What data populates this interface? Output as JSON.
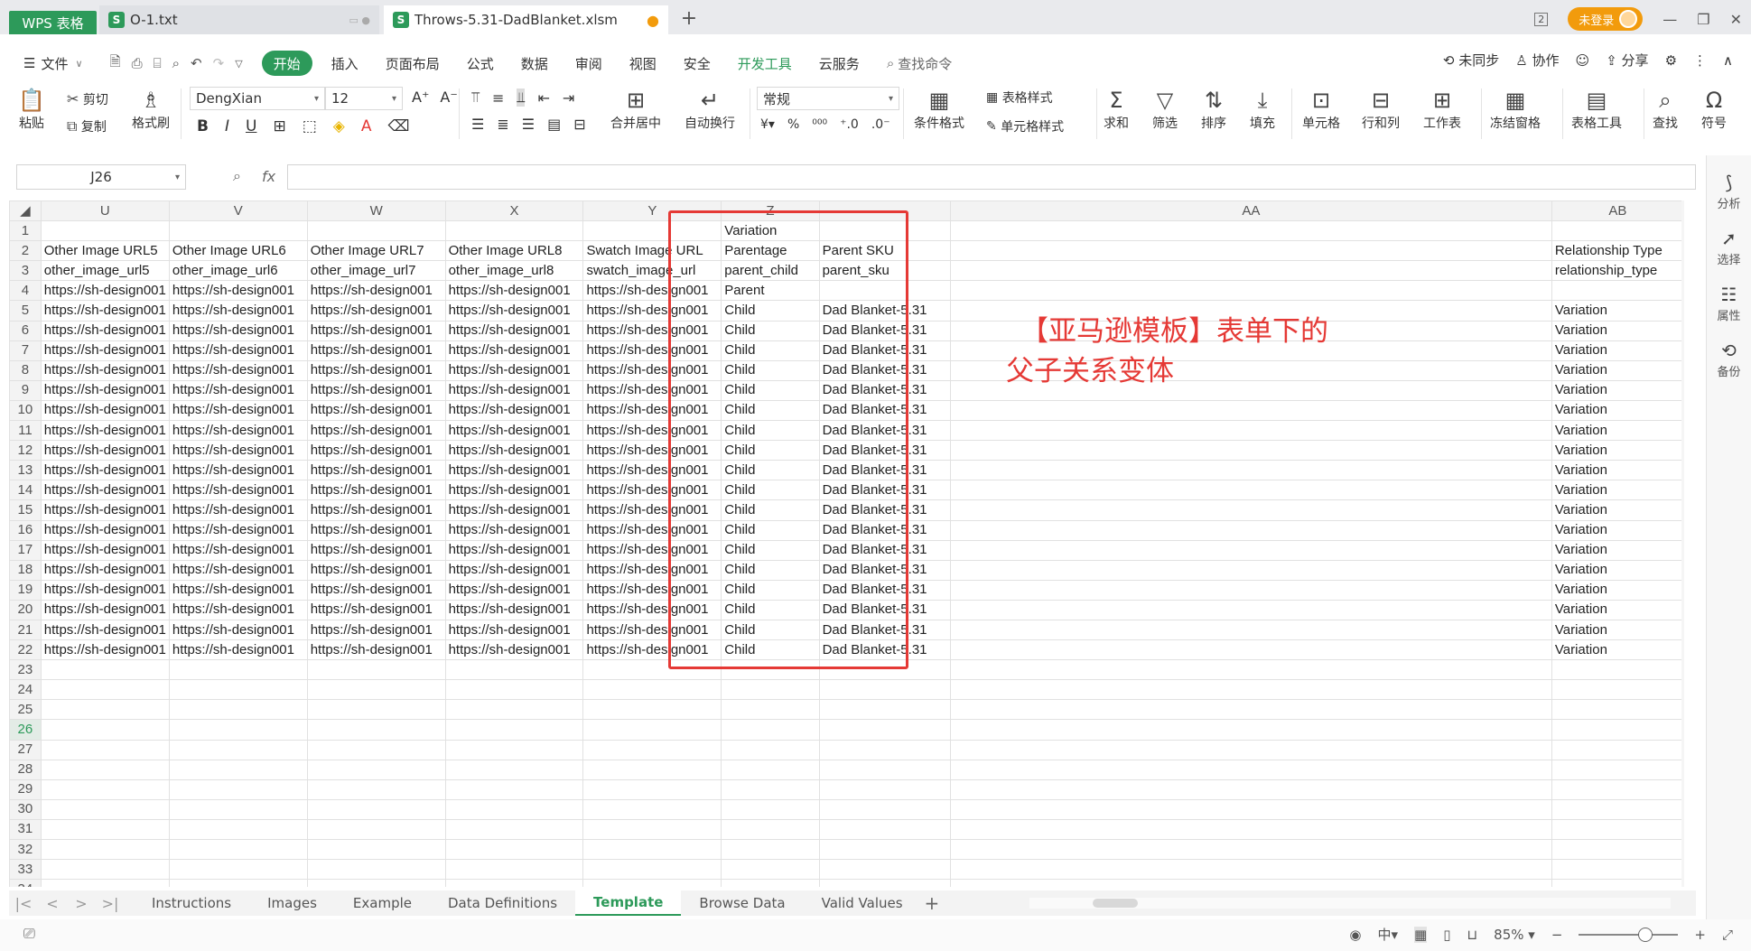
{
  "titlebar": {
    "tabs": [
      {
        "label": "WPS 表格"
      },
      {
        "label": "O-1.txt",
        "icon": "S"
      },
      {
        "label": "Throws-5.31-DadBlanket.xlsm",
        "icon": "S"
      }
    ],
    "new_tab": "+",
    "page_count": "2",
    "login": "未登录"
  },
  "menubar": {
    "file": "文件",
    "items": [
      "开始",
      "插入",
      "页面布局",
      "公式",
      "数据",
      "审阅",
      "视图",
      "安全",
      "开发工具",
      "云服务"
    ],
    "search": "查找命令",
    "right": [
      "未同步",
      "协作",
      "分享"
    ]
  },
  "toolbar": {
    "paste": "粘贴",
    "cut": "剪切",
    "copy": "复制",
    "format_painter": "格式刷",
    "font_name": "DengXian",
    "font_size": "12",
    "number_format": "常规",
    "merge": "合并居中",
    "wrap": "自动换行",
    "cond_format": "条件格式",
    "table_style": "表格样式",
    "cell_style": "单元格样式",
    "sum": "求和",
    "filter": "筛选",
    "sort": "排序",
    "fill": "填充",
    "cell": "单元格",
    "rowcol": "行和列",
    "sheet": "工作表",
    "freeze": "冻结窗格",
    "table_tools": "表格工具",
    "find": "查找",
    "symbol": "符号"
  },
  "formula": {
    "cell_ref": "J26",
    "fx": "fx",
    "value": ""
  },
  "columns": [
    "U",
    "V",
    "W",
    "X",
    "Y",
    "Z",
    "",
    "AA",
    "AB"
  ],
  "rows": [
    {
      "n": "1",
      "cells": [
        "",
        "",
        "",
        "",
        "",
        "Variation",
        "",
        "",
        ""
      ]
    },
    {
      "n": "2",
      "cells": [
        "Other Image URL5",
        "Other Image URL6",
        "Other Image URL7",
        "Other Image URL8",
        "Swatch Image URL",
        "Parentage",
        "Parent SKU",
        "",
        "Relationship Type"
      ]
    },
    {
      "n": "3",
      "cells": [
        "other_image_url5",
        "other_image_url6",
        "other_image_url7",
        "other_image_url8",
        "swatch_image_url",
        "parent_child",
        "parent_sku",
        "",
        "relationship_type"
      ]
    },
    {
      "n": "4",
      "cells": [
        "https://sh-design001",
        "https://sh-design001",
        "https://sh-design001",
        "https://sh-design001",
        "https://sh-design001",
        "Parent",
        "",
        "",
        ""
      ]
    },
    {
      "n": "5",
      "cells": [
        "https://sh-design001",
        "https://sh-design001",
        "https://sh-design001",
        "https://sh-design001",
        "https://sh-design001",
        "Child",
        "Dad Blanket-5.31",
        "",
        "Variation"
      ]
    },
    {
      "n": "6",
      "cells": [
        "https://sh-design001",
        "https://sh-design001",
        "https://sh-design001",
        "https://sh-design001",
        "https://sh-design001",
        "Child",
        "Dad Blanket-5.31",
        "",
        "Variation"
      ]
    },
    {
      "n": "7",
      "cells": [
        "https://sh-design001",
        "https://sh-design001",
        "https://sh-design001",
        "https://sh-design001",
        "https://sh-design001",
        "Child",
        "Dad Blanket-5.31",
        "",
        "Variation"
      ]
    },
    {
      "n": "8",
      "cells": [
        "https://sh-design001",
        "https://sh-design001",
        "https://sh-design001",
        "https://sh-design001",
        "https://sh-design001",
        "Child",
        "Dad Blanket-5.31",
        "",
        "Variation"
      ]
    },
    {
      "n": "9",
      "cells": [
        "https://sh-design001",
        "https://sh-design001",
        "https://sh-design001",
        "https://sh-design001",
        "https://sh-design001",
        "Child",
        "Dad Blanket-5.31",
        "",
        "Variation"
      ]
    },
    {
      "n": "10",
      "cells": [
        "https://sh-design001",
        "https://sh-design001",
        "https://sh-design001",
        "https://sh-design001",
        "https://sh-design001",
        "Child",
        "Dad Blanket-5.31",
        "",
        "Variation"
      ]
    },
    {
      "n": "11",
      "cells": [
        "https://sh-design001",
        "https://sh-design001",
        "https://sh-design001",
        "https://sh-design001",
        "https://sh-design001",
        "Child",
        "Dad Blanket-5.31",
        "",
        "Variation"
      ]
    },
    {
      "n": "12",
      "cells": [
        "https://sh-design001",
        "https://sh-design001",
        "https://sh-design001",
        "https://sh-design001",
        "https://sh-design001",
        "Child",
        "Dad Blanket-5.31",
        "",
        "Variation"
      ]
    },
    {
      "n": "13",
      "cells": [
        "https://sh-design001",
        "https://sh-design001",
        "https://sh-design001",
        "https://sh-design001",
        "https://sh-design001",
        "Child",
        "Dad Blanket-5.31",
        "",
        "Variation"
      ]
    },
    {
      "n": "14",
      "cells": [
        "https://sh-design001",
        "https://sh-design001",
        "https://sh-design001",
        "https://sh-design001",
        "https://sh-design001",
        "Child",
        "Dad Blanket-5.31",
        "",
        "Variation"
      ]
    },
    {
      "n": "15",
      "cells": [
        "https://sh-design001",
        "https://sh-design001",
        "https://sh-design001",
        "https://sh-design001",
        "https://sh-design001",
        "Child",
        "Dad Blanket-5.31",
        "",
        "Variation"
      ]
    },
    {
      "n": "16",
      "cells": [
        "https://sh-design001",
        "https://sh-design001",
        "https://sh-design001",
        "https://sh-design001",
        "https://sh-design001",
        "Child",
        "Dad Blanket-5.31",
        "",
        "Variation"
      ]
    },
    {
      "n": "17",
      "cells": [
        "https://sh-design001",
        "https://sh-design001",
        "https://sh-design001",
        "https://sh-design001",
        "https://sh-design001",
        "Child",
        "Dad Blanket-5.31",
        "",
        "Variation"
      ]
    },
    {
      "n": "18",
      "cells": [
        "https://sh-design001",
        "https://sh-design001",
        "https://sh-design001",
        "https://sh-design001",
        "https://sh-design001",
        "Child",
        "Dad Blanket-5.31",
        "",
        "Variation"
      ]
    },
    {
      "n": "19",
      "cells": [
        "https://sh-design001",
        "https://sh-design001",
        "https://sh-design001",
        "https://sh-design001",
        "https://sh-design001",
        "Child",
        "Dad Blanket-5.31",
        "",
        "Variation"
      ]
    },
    {
      "n": "20",
      "cells": [
        "https://sh-design001",
        "https://sh-design001",
        "https://sh-design001",
        "https://sh-design001",
        "https://sh-design001",
        "Child",
        "Dad Blanket-5.31",
        "",
        "Variation"
      ]
    },
    {
      "n": "21",
      "cells": [
        "https://sh-design001",
        "https://sh-design001",
        "https://sh-design001",
        "https://sh-design001",
        "https://sh-design001",
        "Child",
        "Dad Blanket-5.31",
        "",
        "Variation"
      ]
    },
    {
      "n": "22",
      "cells": [
        "https://sh-design001",
        "https://sh-design001",
        "https://sh-design001",
        "https://sh-design001",
        "https://sh-design001",
        "Child",
        "Dad Blanket-5.31",
        "",
        "Variation"
      ]
    },
    {
      "n": "23",
      "cells": [
        "",
        "",
        "",
        "",
        "",
        "",
        "",
        "",
        ""
      ]
    },
    {
      "n": "24",
      "cells": [
        "",
        "",
        "",
        "",
        "",
        "",
        "",
        "",
        ""
      ]
    },
    {
      "n": "25",
      "cells": [
        "",
        "",
        "",
        "",
        "",
        "",
        "",
        "",
        ""
      ]
    },
    {
      "n": "26",
      "cells": [
        "",
        "",
        "",
        "",
        "",
        "",
        "",
        "",
        ""
      ]
    },
    {
      "n": "27",
      "cells": [
        "",
        "",
        "",
        "",
        "",
        "",
        "",
        "",
        ""
      ]
    },
    {
      "n": "28",
      "cells": [
        "",
        "",
        "",
        "",
        "",
        "",
        "",
        "",
        ""
      ]
    },
    {
      "n": "29",
      "cells": [
        "",
        "",
        "",
        "",
        "",
        "",
        "",
        "",
        ""
      ]
    },
    {
      "n": "30",
      "cells": [
        "",
        "",
        "",
        "",
        "",
        "",
        "",
        "",
        ""
      ]
    },
    {
      "n": "31",
      "cells": [
        "",
        "",
        "",
        "",
        "",
        "",
        "",
        "",
        ""
      ]
    },
    {
      "n": "32",
      "cells": [
        "",
        "",
        "",
        "",
        "",
        "",
        "",
        "",
        ""
      ]
    },
    {
      "n": "33",
      "cells": [
        "",
        "",
        "",
        "",
        "",
        "",
        "",
        "",
        ""
      ]
    },
    {
      "n": "34",
      "cells": [
        "",
        "",
        "",
        "",
        "",
        "",
        "",
        "",
        ""
      ]
    }
  ],
  "active_row": "26",
  "annotation": {
    "line1": "【亚马逊模板】表单下的",
    "line2": "父子关系变体",
    "color": "#e53935"
  },
  "right_panel": [
    "分析",
    "选择",
    "属性",
    "备份"
  ],
  "sheets": [
    "Instructions",
    "Images",
    "Example",
    "Data Definitions",
    "Template",
    "Browse Data",
    "Valid Values"
  ],
  "active_sheet": "Template",
  "status": {
    "zoom": "85%"
  },
  "colors": {
    "accent": "#2d9a5a",
    "login": "#f29b0c",
    "annotation": "#e53935"
  }
}
